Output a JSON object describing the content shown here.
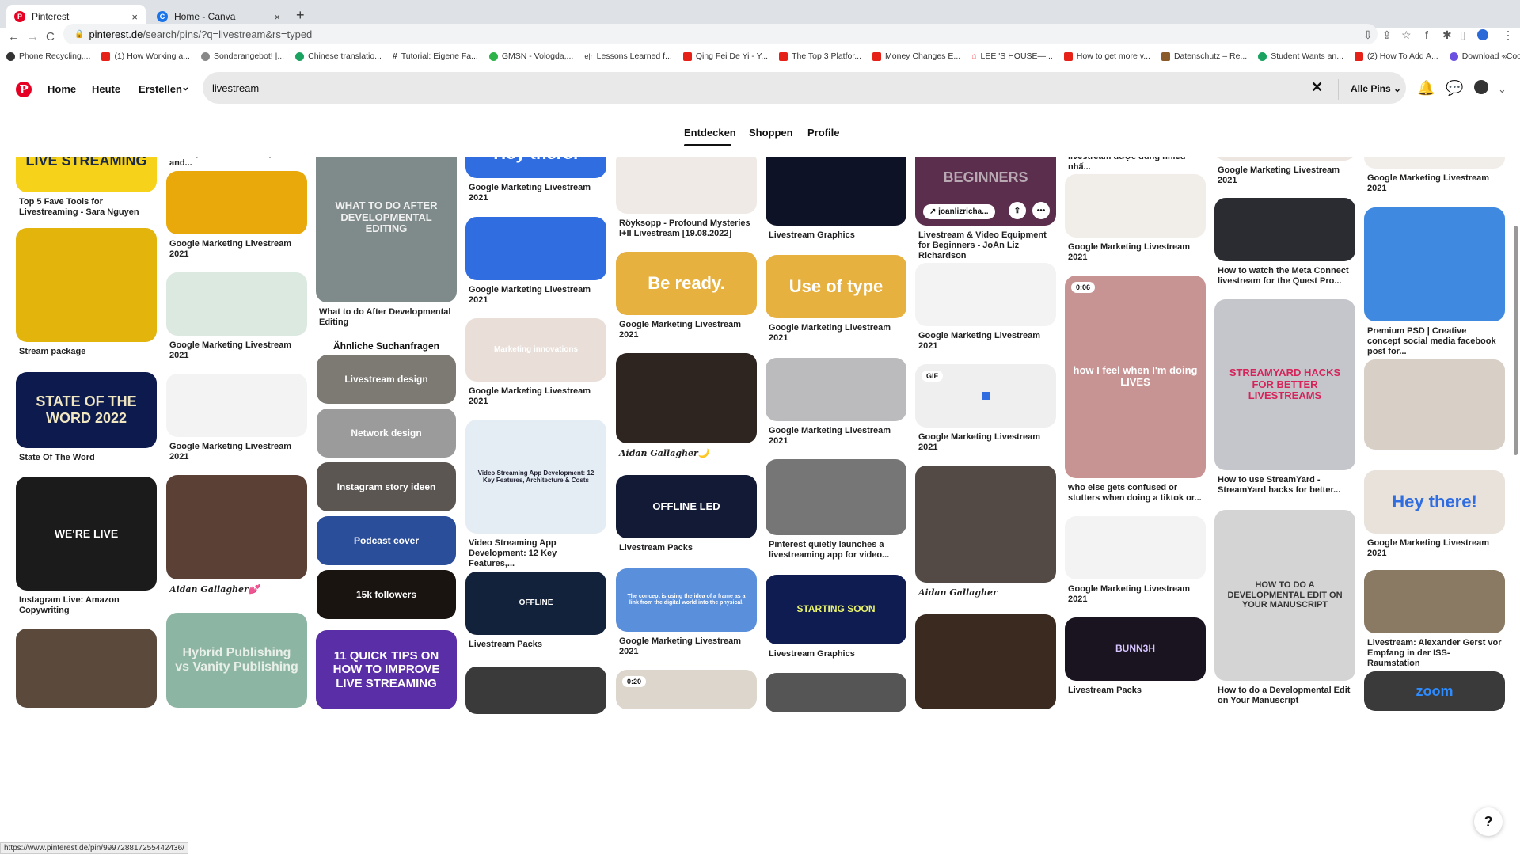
{
  "browser": {
    "tabs": [
      {
        "title": "Pinterest",
        "active": true,
        "favicon": "pinterest-icon",
        "color": "#e60023"
      },
      {
        "title": "Home - Canva",
        "active": false,
        "favicon": "canva-icon",
        "color": "#00c4cc"
      }
    ],
    "close_glyph": "×",
    "new_tab_glyph": "+",
    "url_host": "pinterest.de",
    "url_path": "/search/pins/?q=livestream&rs=typed",
    "nav": {
      "back": "←",
      "forward": "→",
      "reload": "C"
    },
    "bookmarks": [
      {
        "label": "Phone Recycling,...",
        "color": "#333"
      },
      {
        "label": "(1) How Working a...",
        "color": "#e62117"
      },
      {
        "label": "Sonderangebot! |...",
        "color": "#888"
      },
      {
        "label": "Chinese translatio...",
        "color": "#1aa260"
      },
      {
        "label": "Tutorial: Eigene Fa...",
        "color": "#333"
      },
      {
        "label": "GMSN - Vologda,...",
        "color": "#2db34a"
      },
      {
        "label": "Lessons Learned f...",
        "color": "#555"
      },
      {
        "label": "Qing Fei De Yi - Y...",
        "color": "#e62117"
      },
      {
        "label": "The Top 3 Platfor...",
        "color": "#e62117"
      },
      {
        "label": "Money Changes E...",
        "color": "#e62117"
      },
      {
        "label": "LEE 'S HOUSE—...",
        "color": "#ff5a5f"
      },
      {
        "label": "How to get more v...",
        "color": "#e62117"
      },
      {
        "label": "Datenschutz – Re...",
        "color": "#8a5a2b"
      },
      {
        "label": "Student Wants an...",
        "color": "#1aa260"
      },
      {
        "label": "(2) How To Add A...",
        "color": "#e62117"
      },
      {
        "label": "Download - Cooki...",
        "color": "#6b4fe0"
      }
    ],
    "bookmarks_more": "»",
    "status_url": "https://www.pinterest.de/pin/999728817255442436/"
  },
  "header": {
    "logo": "P",
    "nav": [
      "Home",
      "Heute",
      "Erstellen"
    ],
    "search_value": "livestream",
    "clear_glyph": "✕",
    "filter_label": "Alle Pins",
    "chevron": "⌄",
    "tabs": [
      "Entdecken",
      "Shoppen",
      "Profile"
    ],
    "active_tab": "Entdecken"
  },
  "related": {
    "heading": "Ähnliche Suchanfragen",
    "items": [
      "Livestream design",
      "Network design",
      "Instagram story ideen",
      "Podcast cover",
      "15k followers"
    ]
  },
  "pins": [
    {
      "title": "Top 5 Fave Tools for Livestreaming - Sara Nguyen",
      "overlay": "LIVE STREAMING"
    },
    {
      "title": "Stream package",
      "overlay": ""
    },
    {
      "title": "State Of The Word",
      "overlay": "STATE OF THE WORD 2022"
    },
    {
      "title": "Instagram Live: Amazon Copywriting",
      "overlay": "WE'RE LIVE"
    },
    {
      "title": "",
      "overlay": ""
    },
    {
      "title": "Facebook Livestream Mistake to Avoid | Facebook Live tips and...",
      "overlay": ""
    },
    {
      "title": "Google Marketing Livestream 2021",
      "overlay": ""
    },
    {
      "title": "Google Marketing Livestream 2021",
      "overlay": ""
    },
    {
      "title": "Google Marketing Livestream 2021",
      "overlay": ""
    },
    {
      "title": "Aidan Gallagher💕",
      "overlay": ""
    },
    {
      "title": "",
      "overlay": "Hybrid Publishing vs Vanity Publishing"
    },
    {
      "title": "What to do After Developmental Editing",
      "overlay": "WHAT TO DO AFTER DEVELOPMENTAL EDITING"
    },
    {
      "title": "",
      "overlay": "11 QUICK TIPS ON HOW TO IMPROVE LIVE STREAMING"
    },
    {
      "title": "Google Marketing Livestream 2021",
      "overlay": "Hey there!"
    },
    {
      "title": "Google Marketing Livestream 2021",
      "overlay": ""
    },
    {
      "title": "Google Marketing Livestream 2021",
      "overlay": "Marketing innovations"
    },
    {
      "title": "Video Streaming App Development: 12 Key Features,...",
      "overlay": "Video Streaming App Development: 12 Key Features, Architecture & Costs"
    },
    {
      "title": "Livestream Packs",
      "overlay": "OFFLINE"
    },
    {
      "title": "",
      "overlay": ""
    },
    {
      "title": "Röyksopp - Profound Mysteries I+II Livestream [19.08.2022]",
      "overlay": ""
    },
    {
      "title": "Google Marketing Livestream 2021",
      "overlay": "Be ready."
    },
    {
      "title": "Aidan Gallagher🌙",
      "overlay": ""
    },
    {
      "title": "Livestream Packs",
      "overlay": "OFFLINE LED"
    },
    {
      "title": "Google Marketing Livestream 2021",
      "overlay": "The concept is using the idea of a frame as a link from the digital world into the physical."
    },
    {
      "title": "",
      "overlay": "",
      "badge": "0:20"
    },
    {
      "title": "Livestream Graphics",
      "overlay": ""
    },
    {
      "title": "Google Marketing Livestream 2021",
      "overlay": "Use of type"
    },
    {
      "title": "Google Marketing Livestream 2021",
      "overlay": ""
    },
    {
      "title": "Pinterest quietly launches a livestreaming app for video...",
      "overlay": ""
    },
    {
      "title": "Livestream Graphics",
      "overlay": "STARTING SOON"
    },
    {
      "title": "",
      "overlay": ""
    },
    {
      "title": "Livestream & Video Equipment for Beginners - JoAn Liz Richardson",
      "overlay": "BEGINNERS",
      "chip": "joanlizricha..."
    },
    {
      "title": "Google Marketing Livestream 2021",
      "overlay": ""
    },
    {
      "title": "Google Marketing Livestream 2021",
      "overlay": "",
      "badge": "GIF"
    },
    {
      "title": "Aidan Gallagher",
      "overlay": ""
    },
    {
      "title": "",
      "overlay": ""
    },
    {
      "title": "Một số phần mềm chia sẻ livestream được dùng nhiều nhấ...",
      "overlay": ""
    },
    {
      "title": "Google Marketing Livestream 2021",
      "overlay": ""
    },
    {
      "title": "who else gets confused or stutters when doing a tiktok or...",
      "overlay": "how I feel when I'm doing LIVES",
      "badge": "0:06"
    },
    {
      "title": "Google Marketing Livestream 2021",
      "overlay": ""
    },
    {
      "title": "Livestream Packs",
      "overlay": "BUNN3H"
    },
    {
      "title": "Google Marketing Livestream 2021",
      "overlay": ""
    },
    {
      "title": "How to watch the Meta Connect livestream for the Quest Pro...",
      "overlay": ""
    },
    {
      "title": "How to use StreamYard - StreamYard hacks for better...",
      "overlay": "STREAMYARD HACKS FOR BETTER LIVESTREAMS"
    },
    {
      "title": "How to do a Developmental Edit on Your Manuscript",
      "overlay": "HOW TO DO A DEVELOPMENTAL EDIT ON YOUR MANUSCRIPT"
    },
    {
      "title": "Google Marketing Livestream 2021",
      "overlay": ""
    },
    {
      "title": "Premium PSD | Creative concept social media facebook post for...",
      "overlay": ""
    },
    {
      "title": "",
      "overlay": ""
    },
    {
      "title": "Google Marketing Livestream 2021",
      "overlay": "Hey there!"
    },
    {
      "title": "Livestream: Alexander Gerst vor Empfang in der ISS-Raumstation",
      "overlay": ""
    },
    {
      "title": "",
      "overlay": "zoom"
    }
  ],
  "help": "?"
}
